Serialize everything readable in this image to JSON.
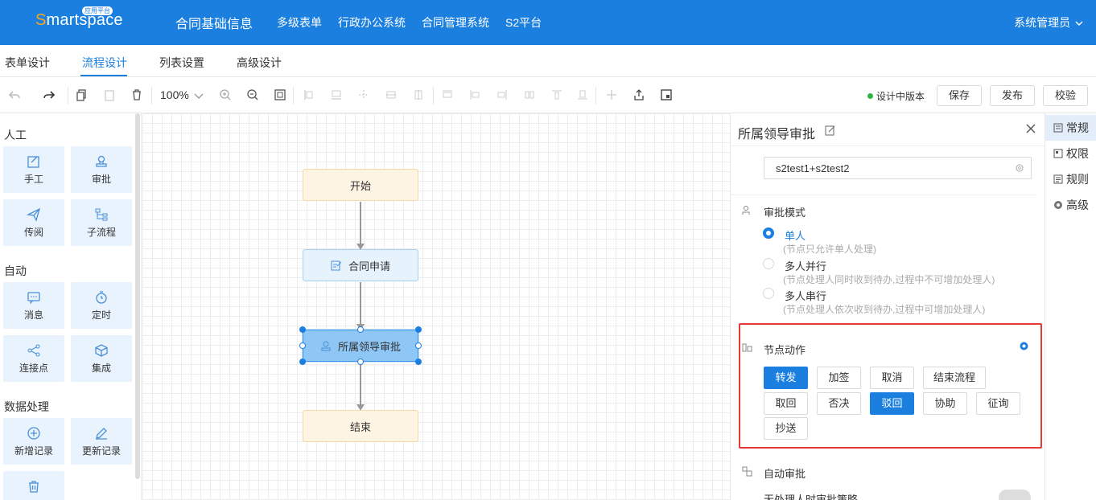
{
  "app": {
    "logo_text_first": "S",
    "logo_text_rest": "martspace",
    "logo_badge": "应用平台",
    "nav": [
      "合同基础信息",
      "多级表单",
      "行政办公系统",
      "合同管理系统",
      "S2平台"
    ],
    "user": "系统管理员"
  },
  "tabs": [
    "表单设计",
    "流程设计",
    "列表设置",
    "高级设计"
  ],
  "active_tab": "流程设计",
  "toolbar": {
    "zoom": "100%",
    "status": "设计中版本",
    "save": "保存",
    "publish": "发布",
    "validate": "校验"
  },
  "palette": {
    "sections": [
      {
        "title": "人工",
        "items": [
          {
            "label": "手工",
            "icon": "edit-icon"
          },
          {
            "label": "审批",
            "icon": "stamp-icon"
          },
          {
            "label": "传阅",
            "icon": "send-icon"
          },
          {
            "label": "子流程",
            "icon": "subprocess-icon"
          }
        ]
      },
      {
        "title": "自动",
        "items": [
          {
            "label": "消息",
            "icon": "message-icon"
          },
          {
            "label": "定时",
            "icon": "timer-icon"
          },
          {
            "label": "连接点",
            "icon": "share-icon"
          },
          {
            "label": "集成",
            "icon": "cube-icon"
          }
        ]
      },
      {
        "title": "数据处理",
        "items": [
          {
            "label": "新增记录",
            "icon": "plus-circle-icon"
          },
          {
            "label": "更新记录",
            "icon": "pen-icon"
          },
          {
            "label": "",
            "icon": "trash-icon"
          }
        ]
      }
    ]
  },
  "flow": {
    "nodes": [
      {
        "id": "start",
        "label": "开始"
      },
      {
        "id": "apply",
        "label": "合同申请"
      },
      {
        "id": "leader",
        "label": "所属领导审批"
      },
      {
        "id": "end",
        "label": "结束"
      }
    ]
  },
  "panel": {
    "title": "所属领导审批",
    "participants": "s2test1+s2test2",
    "approval_mode_title": "审批模式",
    "modes": [
      {
        "label": "单人",
        "desc": "(节点只允许单人处理)",
        "selected": true
      },
      {
        "label": "多人并行",
        "desc": "(节点处理人同时收到待办,过程中不可增加处理人)",
        "selected": false
      },
      {
        "label": "多人串行",
        "desc": "(节点处理人依次收到待办,过程中可增加处理人)",
        "selected": false
      }
    ],
    "actions_title": "节点动作",
    "actions": [
      {
        "label": "转发",
        "on": true
      },
      {
        "label": "加签",
        "on": false
      },
      {
        "label": "取消",
        "on": false
      },
      {
        "label": "结束流程",
        "on": false
      },
      {
        "label": "取回",
        "on": false
      },
      {
        "label": "否决",
        "on": false
      },
      {
        "label": "驳回",
        "on": true
      },
      {
        "label": "协助",
        "on": false
      },
      {
        "label": "征询",
        "on": false
      },
      {
        "label": "抄送",
        "on": false
      }
    ],
    "auto_approve_title": "自动审批",
    "no_handler_policy": "无处理人时审批策略"
  },
  "side_tabs": [
    "常规",
    "权限",
    "规则",
    "高级"
  ],
  "colors": {
    "primary": "#1b7fe0",
    "highlight_border": "#e53935",
    "status_dot": "#2fb344"
  }
}
